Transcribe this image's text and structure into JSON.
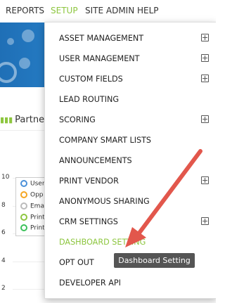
{
  "topnav": {
    "items": [
      {
        "label": "REPORTS"
      },
      {
        "label": "SETUP"
      },
      {
        "label": "SITE ADMIN"
      },
      {
        "label": "HELP"
      }
    ]
  },
  "partner_label": "Partner a",
  "chart": {
    "y_ticks": [
      "10",
      "8",
      "6",
      "4",
      "2"
    ],
    "legend": [
      {
        "label": "User",
        "color": "#4a90d9"
      },
      {
        "label": "Opp",
        "color": "#f5a623"
      },
      {
        "label": "Ema",
        "color": "#bbbbbb"
      },
      {
        "label": "Print",
        "color": "#8dc63f"
      },
      {
        "label": "Print",
        "color": "#3cc15a"
      }
    ]
  },
  "menu": {
    "items": [
      {
        "label": "ASSET MANAGEMENT",
        "has_plus": true
      },
      {
        "label": "USER MANAGEMENT",
        "has_plus": true
      },
      {
        "label": "CUSTOM FIELDS",
        "has_plus": true
      },
      {
        "label": "LEAD ROUTING",
        "has_plus": false
      },
      {
        "label": "SCORING",
        "has_plus": true
      },
      {
        "label": "COMPANY SMART LISTS",
        "has_plus": false
      },
      {
        "label": "ANNOUNCEMENTS",
        "has_plus": false
      },
      {
        "label": "PRINT VENDOR",
        "has_plus": true
      },
      {
        "label": "ANONYMOUS SHARING",
        "has_plus": false
      },
      {
        "label": "CRM SETTINGS",
        "has_plus": true
      },
      {
        "label": "DASHBOARD SETTING",
        "has_plus": false,
        "highlighted": true
      },
      {
        "label": "OPT OUT",
        "has_plus": false
      },
      {
        "label": "DEVELOPER API",
        "has_plus": false
      }
    ]
  },
  "tooltip": "Dashboard Setting",
  "colors": {
    "accent_green": "#8dc63f",
    "banner_blue": "#1f6fb6",
    "arrow_red": "#e2574c"
  }
}
